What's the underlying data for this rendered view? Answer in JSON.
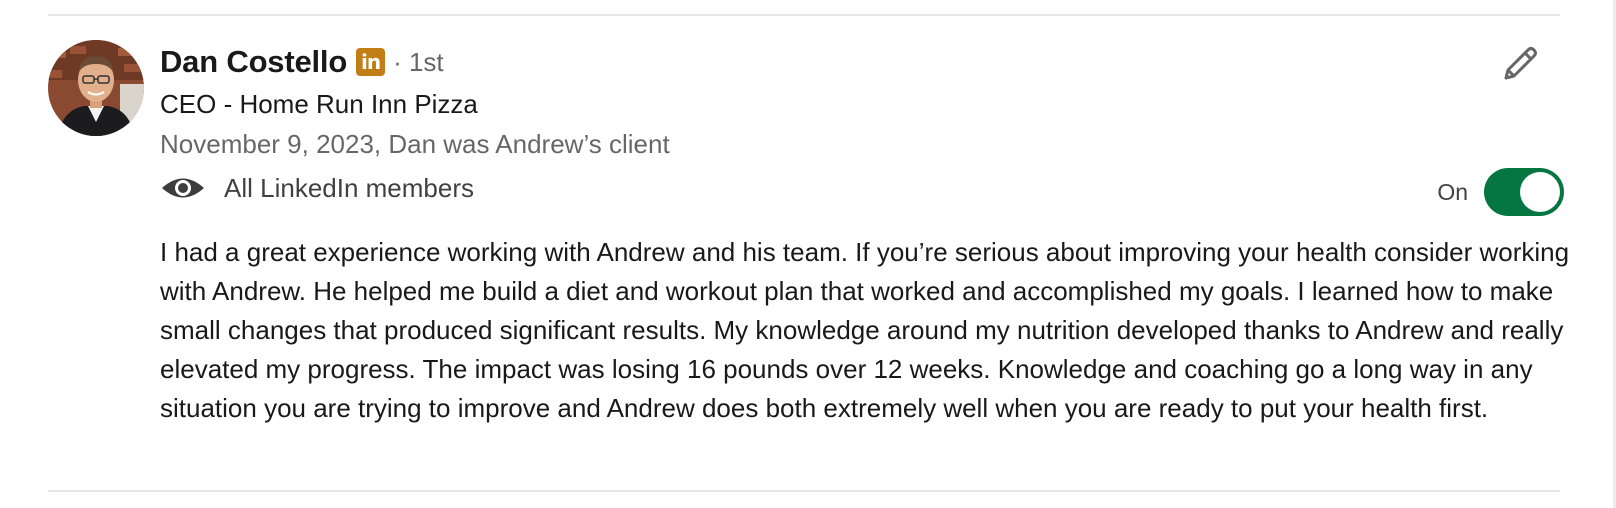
{
  "recommender": {
    "name": "Dan Costello",
    "badge_text": "in",
    "degree": "· 1st",
    "headline": "CEO - Home Run Inn Pizza",
    "meta": "November 9, 2023, Dan was Andrew’s client",
    "avatar_icon": "profile-photo"
  },
  "visibility": {
    "icon": "eye-icon",
    "label": "All LinkedIn members",
    "toggle_label": "On",
    "toggle_on": true
  },
  "actions": {
    "edit_icon": "pencil-icon"
  },
  "recommendation_text": "I had a great experience working with Andrew and his team. If you’re serious about improving your health consider working with Andrew. He helped me build a diet and workout plan that worked and accomplished my goals. I learned how to make small changes that produced significant results. My knowledge around my nutrition developed thanks to Andrew and really elevated my progress. The impact was losing 16 pounds over 12 weeks. Knowledge and coaching go a long way in any situation you are trying to improve and Andrew does both extremely well when you are ready to put your health first.",
  "colors": {
    "toggle_on": "#057642",
    "linkedin_badge": "#c37d16",
    "secondary_text": "#666666"
  }
}
